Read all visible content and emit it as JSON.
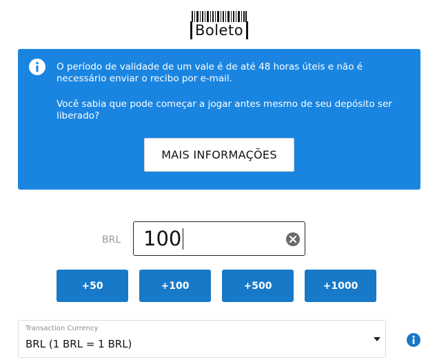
{
  "logo": {
    "text": "Boleto"
  },
  "info_box": {
    "message_1": "O período de validade de um vale é de até 48 horas úteis e não é necessário enviar o recibo por e-mail.",
    "message_2": "Você sabia que pode começar a jogar antes mesmo de seu depósito ser liberado?",
    "button_label": "MAIS INFORMAÇÕES"
  },
  "amount": {
    "currency": "BRL",
    "value": "100"
  },
  "quick_amounts": [
    "+50",
    "+100",
    "+500",
    "+1000"
  ],
  "transaction_currency": {
    "label": "Transaction Currency",
    "selected": "BRL (1 BRL = 1 BRL)"
  },
  "colors": {
    "info_blue": "#1a85e0",
    "button_blue": "#1779c8",
    "help_icon_blue": "#1779c8"
  },
  "icons": {
    "info": "info-circle-icon",
    "clear": "clear-x-circle-icon",
    "dropdown": "caret-down-icon",
    "help": "info-circle-icon"
  }
}
